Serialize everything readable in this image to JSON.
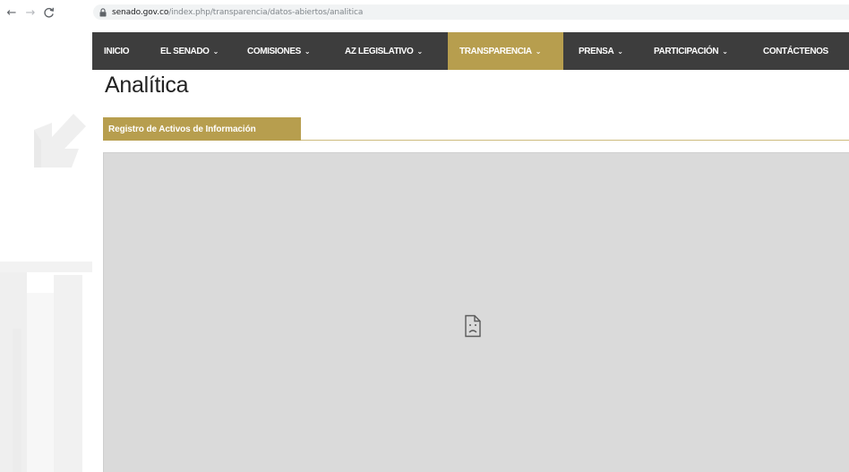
{
  "browser": {
    "url_host": "senado.gov.co",
    "url_path": "/index.php/transparencia/datos-abiertos/analitica"
  },
  "nav": {
    "items": [
      {
        "label": "INICIO",
        "dropdown": false,
        "active": false
      },
      {
        "label": "EL SENADO",
        "dropdown": true,
        "active": false
      },
      {
        "label": "COMISIONES",
        "dropdown": true,
        "active": false
      },
      {
        "label": "AZ LEGISLATIVO",
        "dropdown": true,
        "active": false
      },
      {
        "label": "TRANSPARENCIA",
        "dropdown": true,
        "active": true
      },
      {
        "label": "PRENSA",
        "dropdown": true,
        "active": false
      },
      {
        "label": "PARTICIPACIÓN",
        "dropdown": true,
        "active": false
      },
      {
        "label": "CONTÁCTENOS",
        "dropdown": false,
        "active": false
      }
    ],
    "chevron": "⌄"
  },
  "page": {
    "title": "Analítica",
    "tab_label": "Registro de Activos de Información"
  },
  "colors": {
    "nav_bg": "#3d3d3d",
    "accent_gold": "#b79e4e",
    "frame_gray": "#dadada"
  },
  "icons": {
    "back": "arrow-left-icon",
    "forward": "arrow-right-icon",
    "reload": "reload-icon",
    "lock": "lock-icon",
    "broken": "broken-document-icon"
  }
}
